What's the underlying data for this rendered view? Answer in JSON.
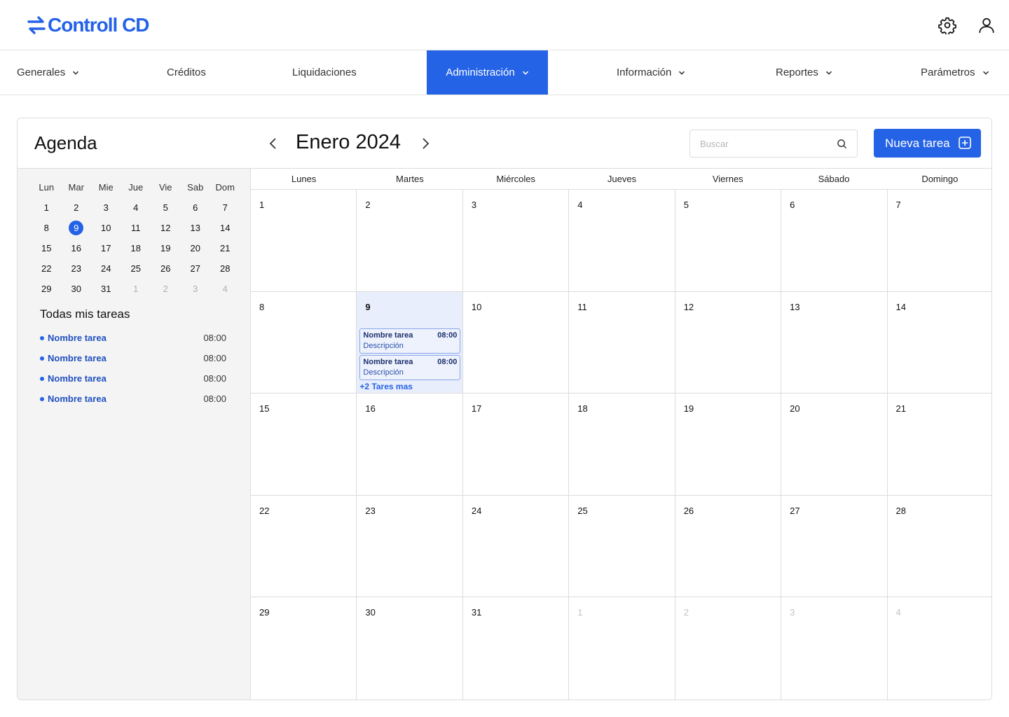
{
  "app": {
    "name": "Controll CD"
  },
  "header": {
    "settings_icon": "gear-icon",
    "user_icon": "user-icon"
  },
  "nav": {
    "items": [
      {
        "label": "Generales",
        "has_dropdown": true
      },
      {
        "label": "Créditos",
        "has_dropdown": false
      },
      {
        "label": "Liquidaciones",
        "has_dropdown": false
      },
      {
        "label": "Administración",
        "has_dropdown": true,
        "active": true
      },
      {
        "label": "Información",
        "has_dropdown": true
      },
      {
        "label": "Reportes",
        "has_dropdown": true
      },
      {
        "label": "Parámetros",
        "has_dropdown": true
      }
    ]
  },
  "sidebar": {
    "title": "Agenda",
    "mini_calendar": {
      "weekdays": [
        "Lun",
        "Mar",
        "Mie",
        "Jue",
        "Vie",
        "Sab",
        "Dom"
      ],
      "selected": "9",
      "weeks": [
        [
          "1",
          "2",
          "3",
          "4",
          "5",
          "6",
          "7"
        ],
        [
          "8",
          "9",
          "10",
          "11",
          "12",
          "13",
          "14"
        ],
        [
          "15",
          "16",
          "17",
          "18",
          "19",
          "20",
          "21"
        ],
        [
          "22",
          "23",
          "24",
          "25",
          "26",
          "27",
          "28"
        ],
        [
          "29",
          "30",
          "31",
          "1",
          "2",
          "3",
          "4"
        ]
      ],
      "trailing_muted_count": 4
    },
    "tasks_title": "Todas mis tareas",
    "tasks": [
      {
        "name": "Nombre tarea",
        "time": "08:00"
      },
      {
        "name": "Nombre tarea",
        "time": "08:00"
      },
      {
        "name": "Nombre tarea",
        "time": "08:00"
      },
      {
        "name": "Nombre tarea",
        "time": "08:00"
      }
    ]
  },
  "main": {
    "month_title": "Enero 2024",
    "search": {
      "placeholder": "Buscar",
      "value": ""
    },
    "new_task_label": "Nueva tarea",
    "weekdays": [
      "Lunes",
      "Martes",
      "Miércoles",
      "Jueves",
      "Viernes",
      "Sábado",
      "Domingo"
    ],
    "today": "9",
    "weeks": [
      [
        "1",
        "2",
        "3",
        "4",
        "5",
        "6",
        "7"
      ],
      [
        "8",
        "9",
        "10",
        "11",
        "12",
        "13",
        "14"
      ],
      [
        "15",
        "16",
        "17",
        "18",
        "19",
        "20",
        "21"
      ],
      [
        "22",
        "23",
        "24",
        "25",
        "26",
        "27",
        "28"
      ],
      [
        "29",
        "30",
        "31",
        "1",
        "2",
        "3",
        "4"
      ]
    ],
    "trailing_muted_count": 4,
    "events_day_9": [
      {
        "name": "Nombre tarea",
        "time": "08:00",
        "description": "Descripción"
      },
      {
        "name": "Nombre tarea",
        "time": "08:00",
        "description": "Descripción"
      }
    ],
    "more_label": "+2 Tares mas"
  },
  "colors": {
    "accent": "#2563e6",
    "today_bg": "#e9eefd",
    "task_text": "#1f4fbf"
  }
}
